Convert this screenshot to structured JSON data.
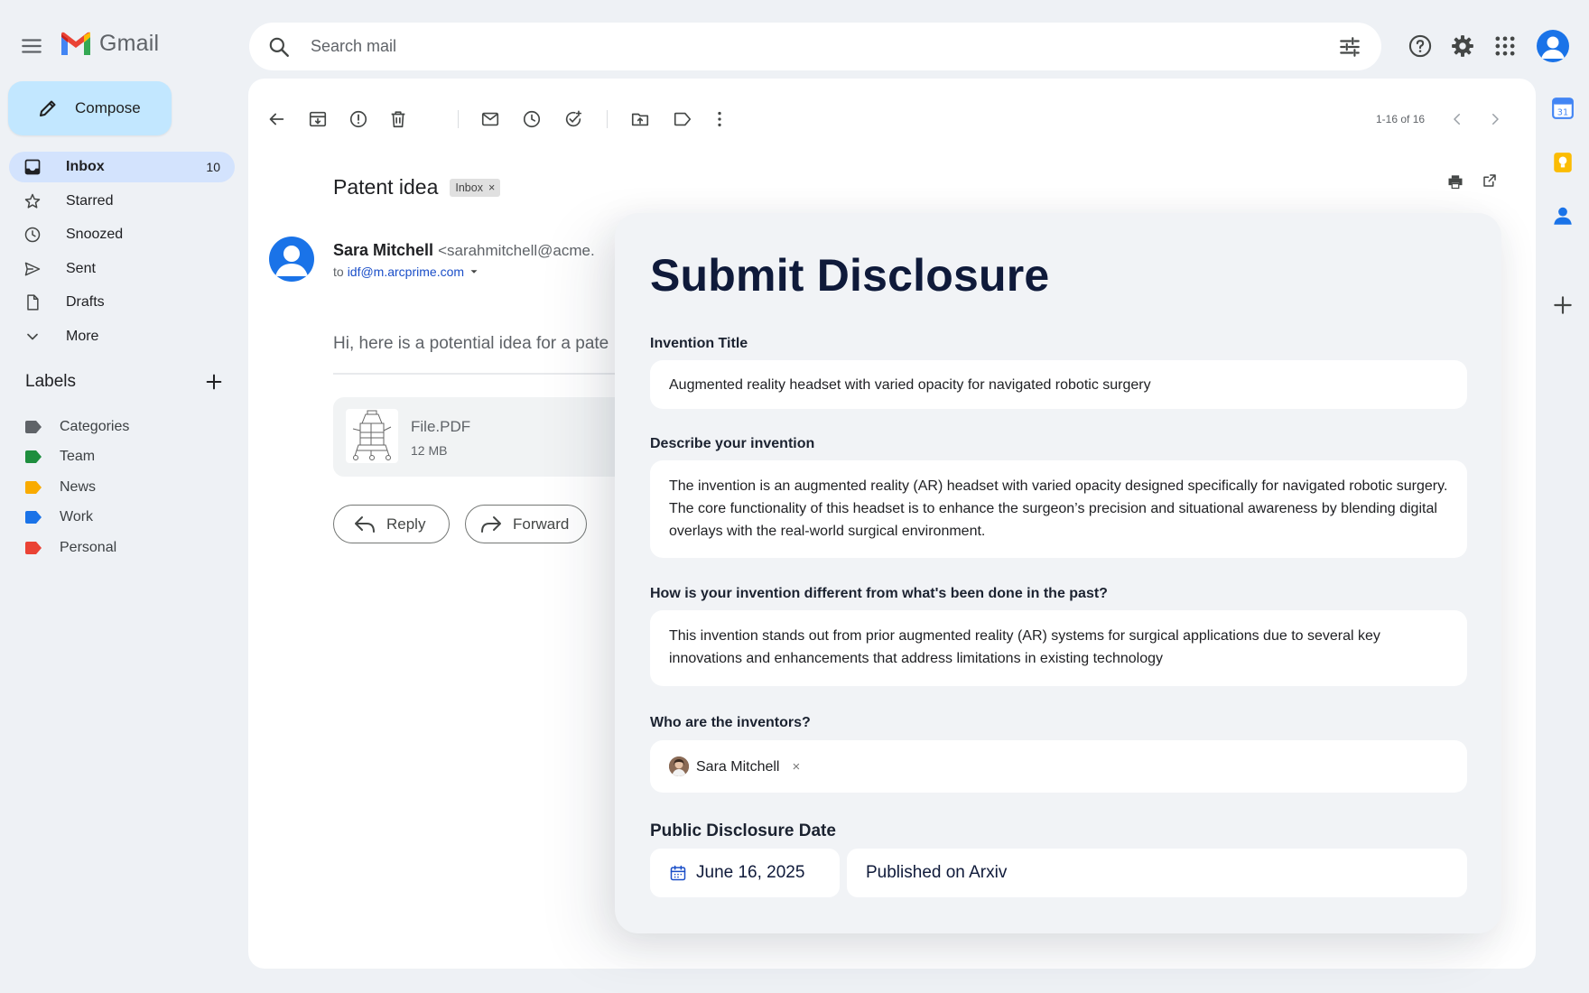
{
  "app": {
    "name": "Gmail"
  },
  "search": {
    "placeholder": "Search mail"
  },
  "compose": {
    "label": "Compose"
  },
  "nav": {
    "items": [
      {
        "label": "Inbox",
        "count": "10",
        "icon": "inbox-icon"
      },
      {
        "label": "Starred",
        "icon": "star-icon"
      },
      {
        "label": "Snoozed",
        "icon": "clock-icon"
      },
      {
        "label": "Sent",
        "icon": "send-icon"
      },
      {
        "label": "Drafts",
        "icon": "draft-icon"
      },
      {
        "label": "More",
        "icon": "chevron-down-icon"
      }
    ]
  },
  "labels": {
    "title": "Labels",
    "items": [
      {
        "name": "Categories",
        "color": "#5f6368"
      },
      {
        "name": "Team",
        "color": "#1e8e3e"
      },
      {
        "name": "News",
        "color": "#f9ab00"
      },
      {
        "name": "Work",
        "color": "#1a73e8"
      },
      {
        "name": "Personal",
        "color": "#ea4335"
      }
    ]
  },
  "toolbar": {
    "pager": "1-16 of 16"
  },
  "email": {
    "subject": "Patent idea",
    "label_chip": "Inbox",
    "sender_name": "Sara Mitchell",
    "sender_email": "<sarahmitchell@acme.",
    "to_prefix": "to",
    "to_address": "idf@m.arcprime.com",
    "greeting": "Hi, here is a potential idea for a pate",
    "attachment": {
      "name": "File.PDF",
      "size": "12 MB"
    },
    "reply_label": "Reply",
    "forward_label": "Forward"
  },
  "disclosure": {
    "title": "Submit Disclosure",
    "invention_title_label": "Invention Title",
    "invention_title_value": "Augmented reality headset with varied opacity for navigated robotic surgery",
    "describe_label": "Describe your invention",
    "describe_value": "The invention is an augmented reality (AR) headset with varied opacity designed specifically for navigated robotic surgery. The core functionality of this headset is to enhance the surgeon’s precision and situational awareness by blending digital overlays with the real-world surgical environment.",
    "different_label": "How is your invention different from what's been done in the past?",
    "different_value": "This invention stands out from prior augmented reality (AR) systems for surgical applications due to several key innovations and enhancements that address limitations in existing technology",
    "inventors_label": "Who are the inventors?",
    "inventor_name": "Sara Mitchell",
    "date_label": "Public Disclosure Date",
    "date_value": "June 16, 2025",
    "published_value": "Published on Arxiv"
  },
  "colors": {
    "accent": "#1a73e8",
    "compose_bg": "#c2e7ff",
    "active_nav": "#d3e3fd",
    "card_bg": "#f1f3f6",
    "title_text": "#0f1a3a"
  }
}
